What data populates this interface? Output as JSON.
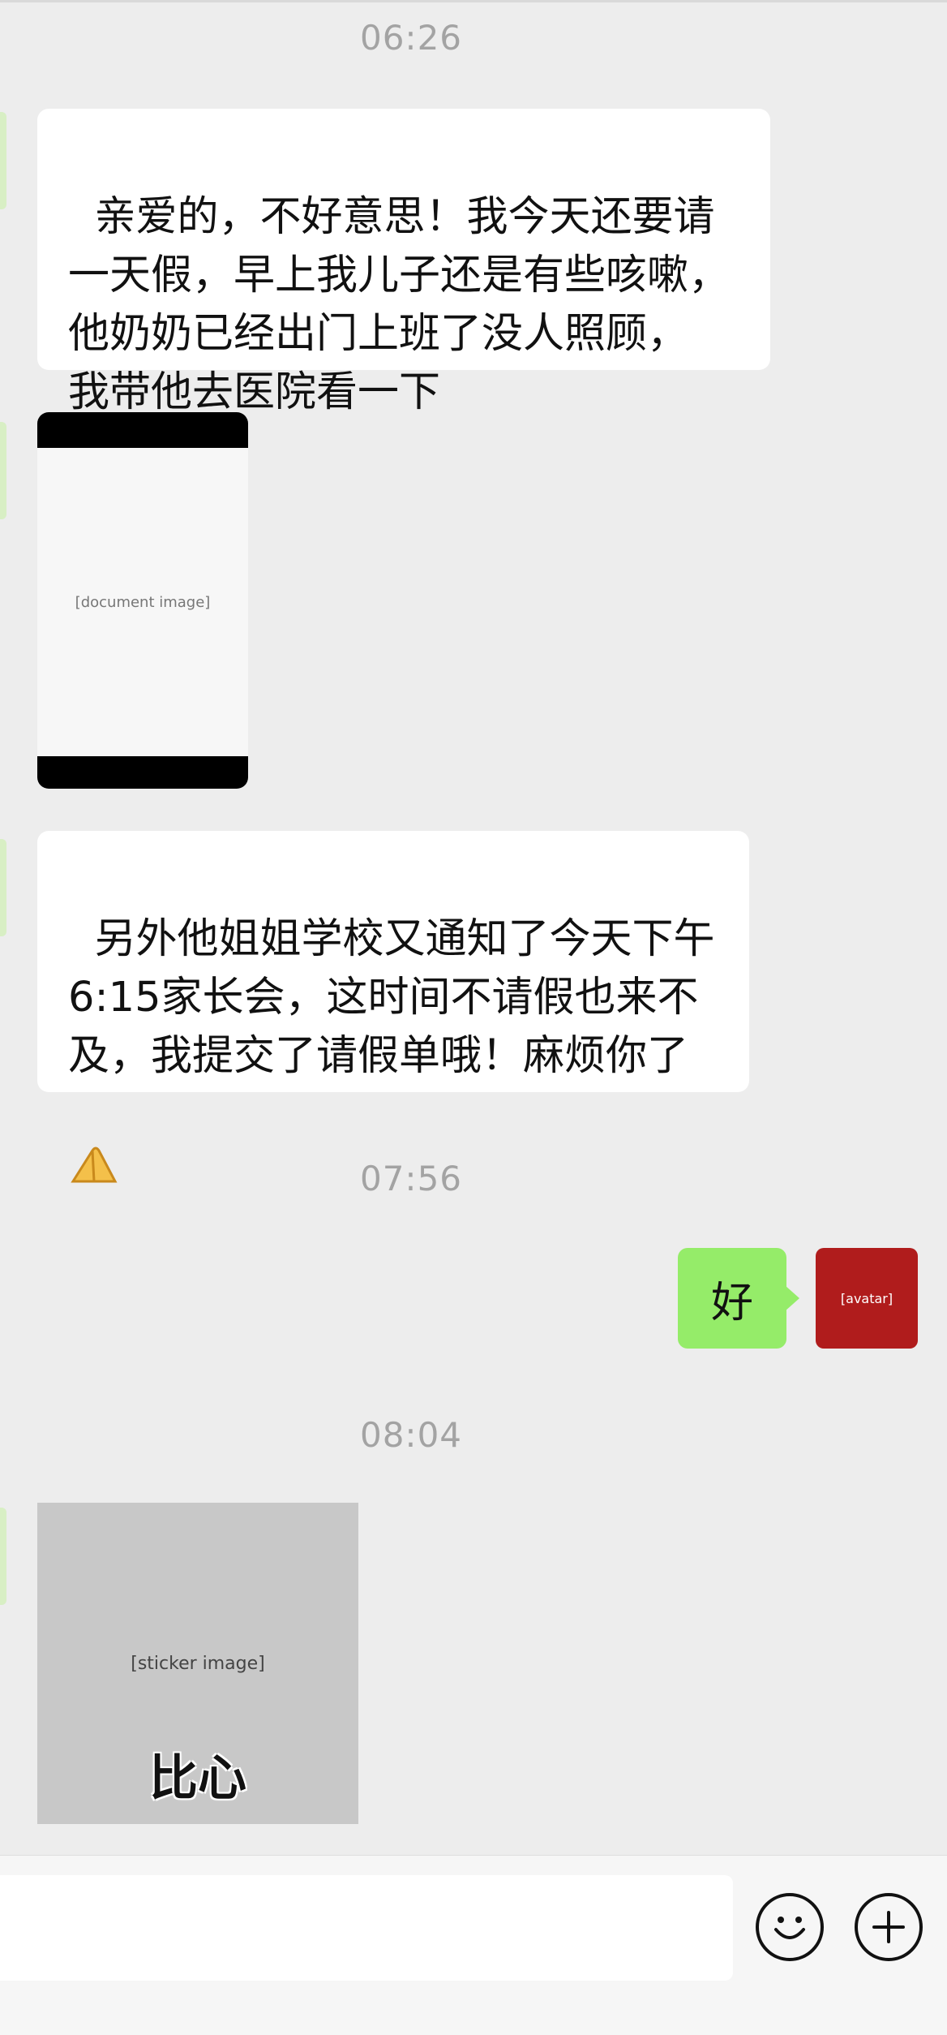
{
  "timestamps": [
    "06:26",
    "07:56",
    "08:04"
  ],
  "messages": {
    "msg1": "亲爱的，不好意思！我今天还要请\n一天假，早上我儿子还是有些咳嗽，\n他奶奶已经出门上班了没人照顾，\n我带他去医院看一下",
    "msg2": "另外他姐姐学校又通知了今天下午\n6:15家长会，这时间不请假也来不\n及，我提交了请假单哦！麻烦你了",
    "reply": "好"
  },
  "sticker": {
    "caption": "比心"
  },
  "icons": {
    "emoji": "emoji-icon",
    "plus": "plus-icon",
    "clap": "folded-hands-emoji"
  },
  "colors": {
    "background": "#ededed",
    "bubble_in": "#ffffff",
    "bubble_out": "#95ec69",
    "timestamp": "#a3a3a3"
  }
}
